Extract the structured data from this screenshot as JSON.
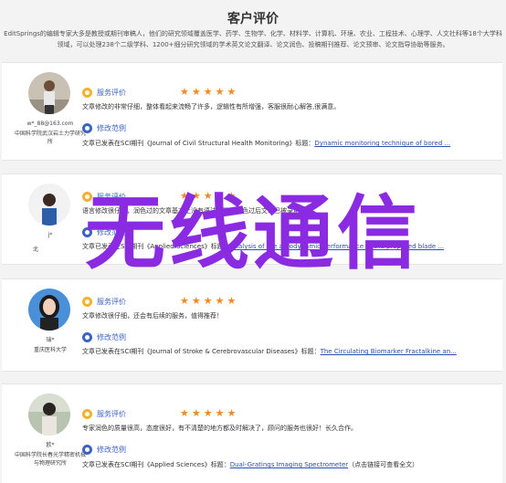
{
  "page_title": "客户评价",
  "intro": "EditSprings的编辑专家大多是教授或期刊审稿人，他们的研究领域覆盖医学、药学、生物学、化学、材料学、计算机、环境、农业、工程技术、心理学、人文社科等18个大学科领域，可以处理238个二级学科、1200+细分研究领域的学术英文论文翻译、论文润色、投稿期刊推荐、论文预审、论文指导协助等服务。",
  "labels": {
    "service_review": "服务评价",
    "sample": "修改范例",
    "stars": "★★★★★"
  },
  "reviews": [
    {
      "user": "w*_88@163.com",
      "org": "中国科学院武汉岩土力学研究所",
      "text": "文章修改的非常仔细，整体看起来流畅了许多，逻辑性有所增强，客服很耐心解答,很满意。",
      "pub_prefix": "文章已发表在SCI期刊《",
      "journal": "Journal of Civil Structural Health Monitoring",
      "pub_mid": "》标题：",
      "title": "Dynamic monitoring technique of bored ..."
    },
    {
      "user": "j*",
      "org": "北",
      "text": "语言修改很仔细，润色过的文章基本上没有语法问题，润色过后文章已被录用。",
      "pub_prefix": "文章已发表在SCI期刊《",
      "journal": "Applied Sciences",
      "pub_mid": "》标题：",
      "title": "Analysis of the aerodynamic performance of the proposed blade ..."
    },
    {
      "user": "瑞*",
      "org": "重庆医科大学",
      "text": "文章修改很仔细，还会有后续的服务，值得推荐！",
      "pub_prefix": "文章已发表在SCI期刊《",
      "journal": "Journal of Stroke & Cerebrovascular Diseases",
      "pub_mid": "》标题：",
      "title": "The Circulating Biomarker Fractalkine an..."
    },
    {
      "user": "欧*",
      "org": "中国科学院长春光学精密机械与物理研究所",
      "text": "专家润色的质量很高，态度很好，有不清楚的地方都及时解决了，顾问的服务也很好！长久合作。",
      "pub_prefix": "文章已发表在SCI期刊《",
      "journal": "Applied Sciences",
      "pub_mid": "》标题：",
      "title": "Dual-Gratings Imaging Spectrometer",
      "note": "（点击链接可查看全文）"
    }
  ],
  "overlay_text": "无线通信",
  "colors": {
    "accent": "#3b63c6",
    "stars": "#f08a24",
    "overlay": "#8a2be2"
  }
}
